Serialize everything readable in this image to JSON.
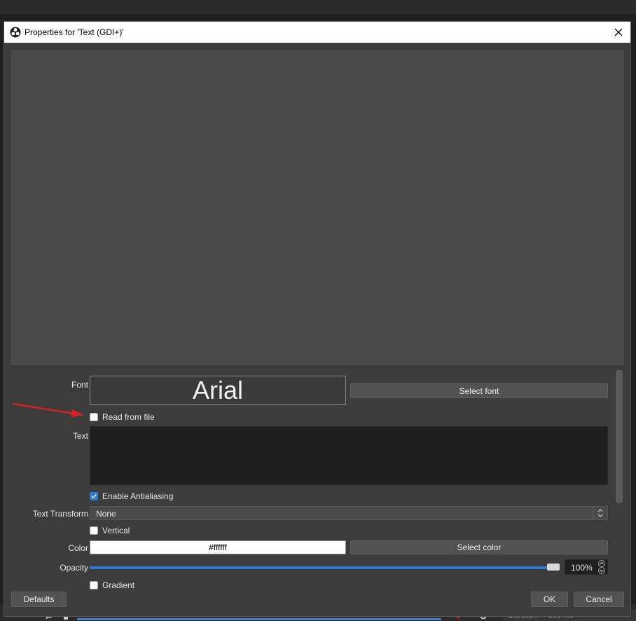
{
  "window": {
    "title": "Properties for 'Text (GDI+)'"
  },
  "font": {
    "label": "Font",
    "preview": "Arial",
    "select_button": "Select font"
  },
  "read_from_file": {
    "label": "Read from file",
    "checked": false
  },
  "text": {
    "label": "Text",
    "value": ""
  },
  "antialiasing": {
    "label": "Enable Antialiasing",
    "checked": true
  },
  "text_transform": {
    "label": "Text Transform",
    "value": "None"
  },
  "vertical": {
    "label": "Vertical",
    "checked": false
  },
  "color": {
    "label": "Color",
    "value": "#ffffff",
    "select_button": "Select color"
  },
  "opacity": {
    "label": "Opacity",
    "value": "100%",
    "level": 1.0
  },
  "gradient": {
    "label": "Gradient",
    "checked": false
  },
  "buttons": {
    "defaults": "Defaults",
    "ok": "OK",
    "cancel": "Cancel"
  },
  "background_app": {
    "duration_label": "Duration",
    "duration_value": "300 ms"
  },
  "colors": {
    "accent": "#2e7ad1",
    "dialog_bg": "#3c3c3c",
    "preview_bg": "#4a4a4a",
    "annotation": "#e02020"
  }
}
